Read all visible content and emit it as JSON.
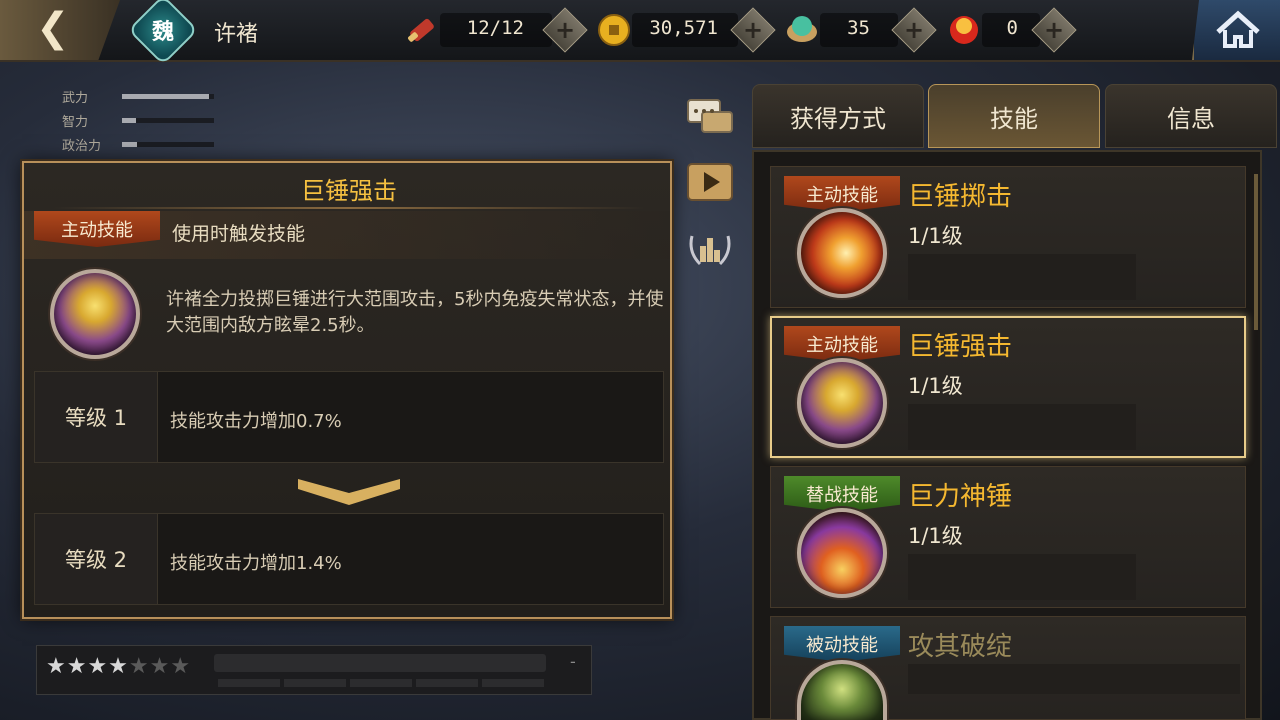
{
  "topbar": {
    "back_icon": "chevron-left-icon",
    "faction_char": "魏",
    "hero_name": "许褚",
    "resources": [
      {
        "name": "stamina",
        "icon": "scroll-icon",
        "value": "12/12"
      },
      {
        "name": "gold",
        "icon": "coin-icon",
        "value": "30,571"
      },
      {
        "name": "jade",
        "icon": "jade-icon",
        "value": "35"
      },
      {
        "name": "gem",
        "icon": "red-gem-icon",
        "value": "0"
      }
    ],
    "home_icon": "home-icon"
  },
  "stats": [
    {
      "label": "武力",
      "fill": 0.95
    },
    {
      "label": "智力",
      "fill": 0.15
    },
    {
      "label": "政治力",
      "fill": 0.16
    }
  ],
  "detail": {
    "title": "巨锤强击",
    "type_tag": "主动技能",
    "trigger": "使用时触发技能",
    "description": "许褚全力投掷巨锤进行大范围攻击，5秒内免疫失常状态，并使大范围内敌方眩晕2.5秒。",
    "levels": [
      {
        "label": "等级 1",
        "effect": "技能攻击力增加0.7%"
      },
      {
        "label": "等级 2",
        "effect": "技能攻击力增加1.4%"
      }
    ],
    "expand_icon": "chevron-down-icon"
  },
  "side_buttons": [
    "chat-icon",
    "play-icon",
    "ranking-icon"
  ],
  "tabs": [
    {
      "label": "获得方式",
      "active": false
    },
    {
      "label": "技能",
      "active": true
    },
    {
      "label": "信息",
      "active": false
    }
  ],
  "skills": [
    {
      "tag": "主动技能",
      "tag_type": "active",
      "name": "巨锤掷击",
      "level": "1/1级",
      "icon": "hammer-throw-icon"
    },
    {
      "tag": "主动技能",
      "tag_type": "active",
      "name": "巨锤强击",
      "level": "1/1级",
      "icon": "hammer-strike-icon",
      "selected": true
    },
    {
      "tag": "替战技能",
      "tag_type": "swap",
      "name": "巨力神锤",
      "level": "1/1级",
      "icon": "mighty-hammer-icon"
    },
    {
      "tag": "被动技能",
      "tag_type": "passive",
      "name": "攻其破绽",
      "level": "",
      "icon": "passive-skill-icon"
    }
  ],
  "rating": {
    "stars_full": 4,
    "stars_total": 7,
    "dash": "-"
  }
}
